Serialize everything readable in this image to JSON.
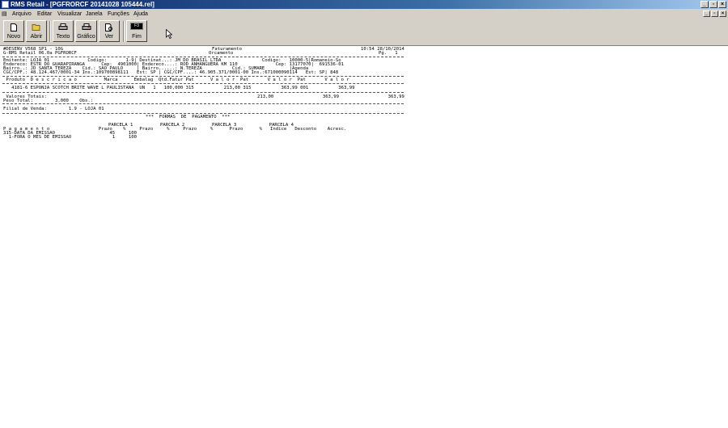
{
  "window": {
    "title": "RMS Retail - [PGFRORCF 20141028 105444.rel]"
  },
  "menu": [
    "Arquivo",
    "Editar",
    "Visualizar",
    "Janela",
    "Funções",
    "Ajuda"
  ],
  "toolbar": {
    "novo": "Novo",
    "abrir": "Abrir",
    "texto": "Texto",
    "grafico": "Gráfico",
    "ver": "Ver",
    "fim": "Fim",
    "fim_key": "F3"
  },
  "report": {
    "h1_left": "#DESENV V568 SP1 - 10G",
    "h1_mid": "Faturamento",
    "h1_right": "10:54 28/10/2014",
    "h2_left": "G-RMS Retail 06.0a PGFRORCF",
    "h2_mid": "Orcamento",
    "h2_right": "Pg.   1",
    "e1": "Emitente: LOJA 01              Codigo:       1-9| Destinat...: JM DO BRASIL LTDA               Codigo:   10000-5|Romaneio-So",
    "e2": "Endereco: ESTR DO GUARAPIRANGA      Cep:  4901000| Endereco....: ROD ANHANGUERA KM 110              Cep: 13177070|  691536-01",
    "e3": "Bairro..: JD SANTA TEREZA    Cid.: SAO PAULO     | Bairro......: N.TEREZA           Cid.: SUMARE         |Agenda",
    "e4": "CGC/CPF.: 48.124.467/0001-34 Ins.:109700898111   Est: SP | CGC/CPF....: 46.905.371/0001-00 Ins.:671000090114   Est: SP| 848",
    "cols": " Produto  D e s c r i c a o          Marca      Embalag  Qtd.Fatur Pat      V a l o r  Pat       V a l o r  Pat       V a l o r",
    "item1": "   4181-6 ESPONJA SCOTCH BRITE WAVE L PAULISTANA  UN   1   100,000 315           213,00 315           363,99 001           363,99",
    "tot_label": " Valores Totais:",
    "tot_vals": "213,00                  363,99                  363,99",
    "peso": "Peso Total:        3,000    Obs.:",
    "filial": "Filial de Venda:        1.9 - LOJA 01",
    "formas_title": "***  FORMAS  DE  PAGAMENTO  ***",
    "parc_hdr": "PARCELA 1          PARCELA 2          PARCELA 3            PARCELA 4",
    "pag_hdr": "P a g a m e n t o                  Prazo    %     Prazo     %     Prazo     %      Prazo      %   Indice   Desconto    Acresc.",
    "pag1": "315-DATA DA EMISSAO                    45     100",
    "pag2": "  1-FORA O MES DE EMISSAO               1     100"
  }
}
